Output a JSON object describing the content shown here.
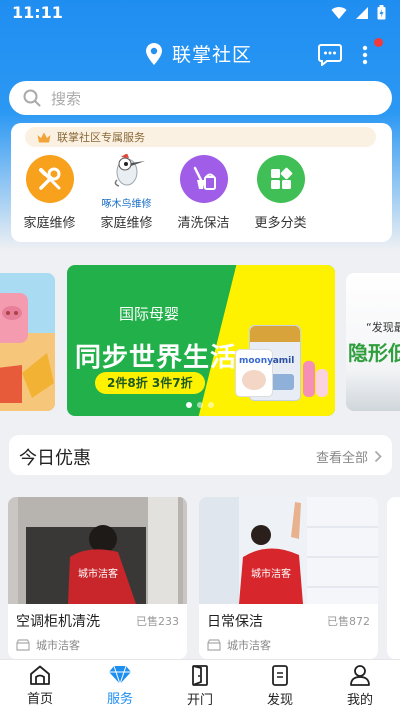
{
  "status": {
    "time": "11:11"
  },
  "header": {
    "title": "联掌社区"
  },
  "search": {
    "placeholder": "搜索"
  },
  "services": {
    "tag": "联掌社区专属服务",
    "items": [
      {
        "label": "家庭维修",
        "icon": "wrench-screwdriver-icon",
        "color": "#f7a11c"
      },
      {
        "label": "家庭维修",
        "icon": "woodpecker-logo-icon",
        "badge": "啄木鸟维修"
      },
      {
        "label": "清洗保洁",
        "icon": "cleaning-bucket-icon",
        "color": "#a05de8"
      },
      {
        "label": "更多分类",
        "icon": "grid-icon",
        "color": "#3fbf55"
      }
    ]
  },
  "banner": {
    "right_line1": "“发现最",
    "right_line2": "隐形低",
    "main_sub": "国际母婴",
    "main_title": "同步世界生活",
    "main_promo": "2件8折 3件7折",
    "product_brands": [
      "moony",
      "Aptamil"
    ],
    "dots": 3,
    "active_dot": 0
  },
  "deals": {
    "title": "今日优惠",
    "view_all": "查看全部"
  },
  "products": [
    {
      "name": "空调柜机清洗",
      "sold": "已售233",
      "shop": "城市洁客",
      "shirt_text": "城市洁客"
    },
    {
      "name": "日常保洁",
      "sold": "已售872",
      "shop": "城市洁客",
      "shirt_text": "城市洁客"
    }
  ],
  "tabbar": {
    "items": [
      {
        "label": "首页",
        "icon": "home-icon"
      },
      {
        "label": "服务",
        "icon": "diamond-icon",
        "active": true
      },
      {
        "label": "开门",
        "icon": "door-icon"
      },
      {
        "label": "发现",
        "icon": "document-icon"
      },
      {
        "label": "我的",
        "icon": "person-icon"
      }
    ]
  },
  "colors": {
    "primary": "#1f8ef1",
    "badge": "#f23a3a",
    "banner_green": "#22b04a",
    "banner_yellow": "#fff200"
  }
}
